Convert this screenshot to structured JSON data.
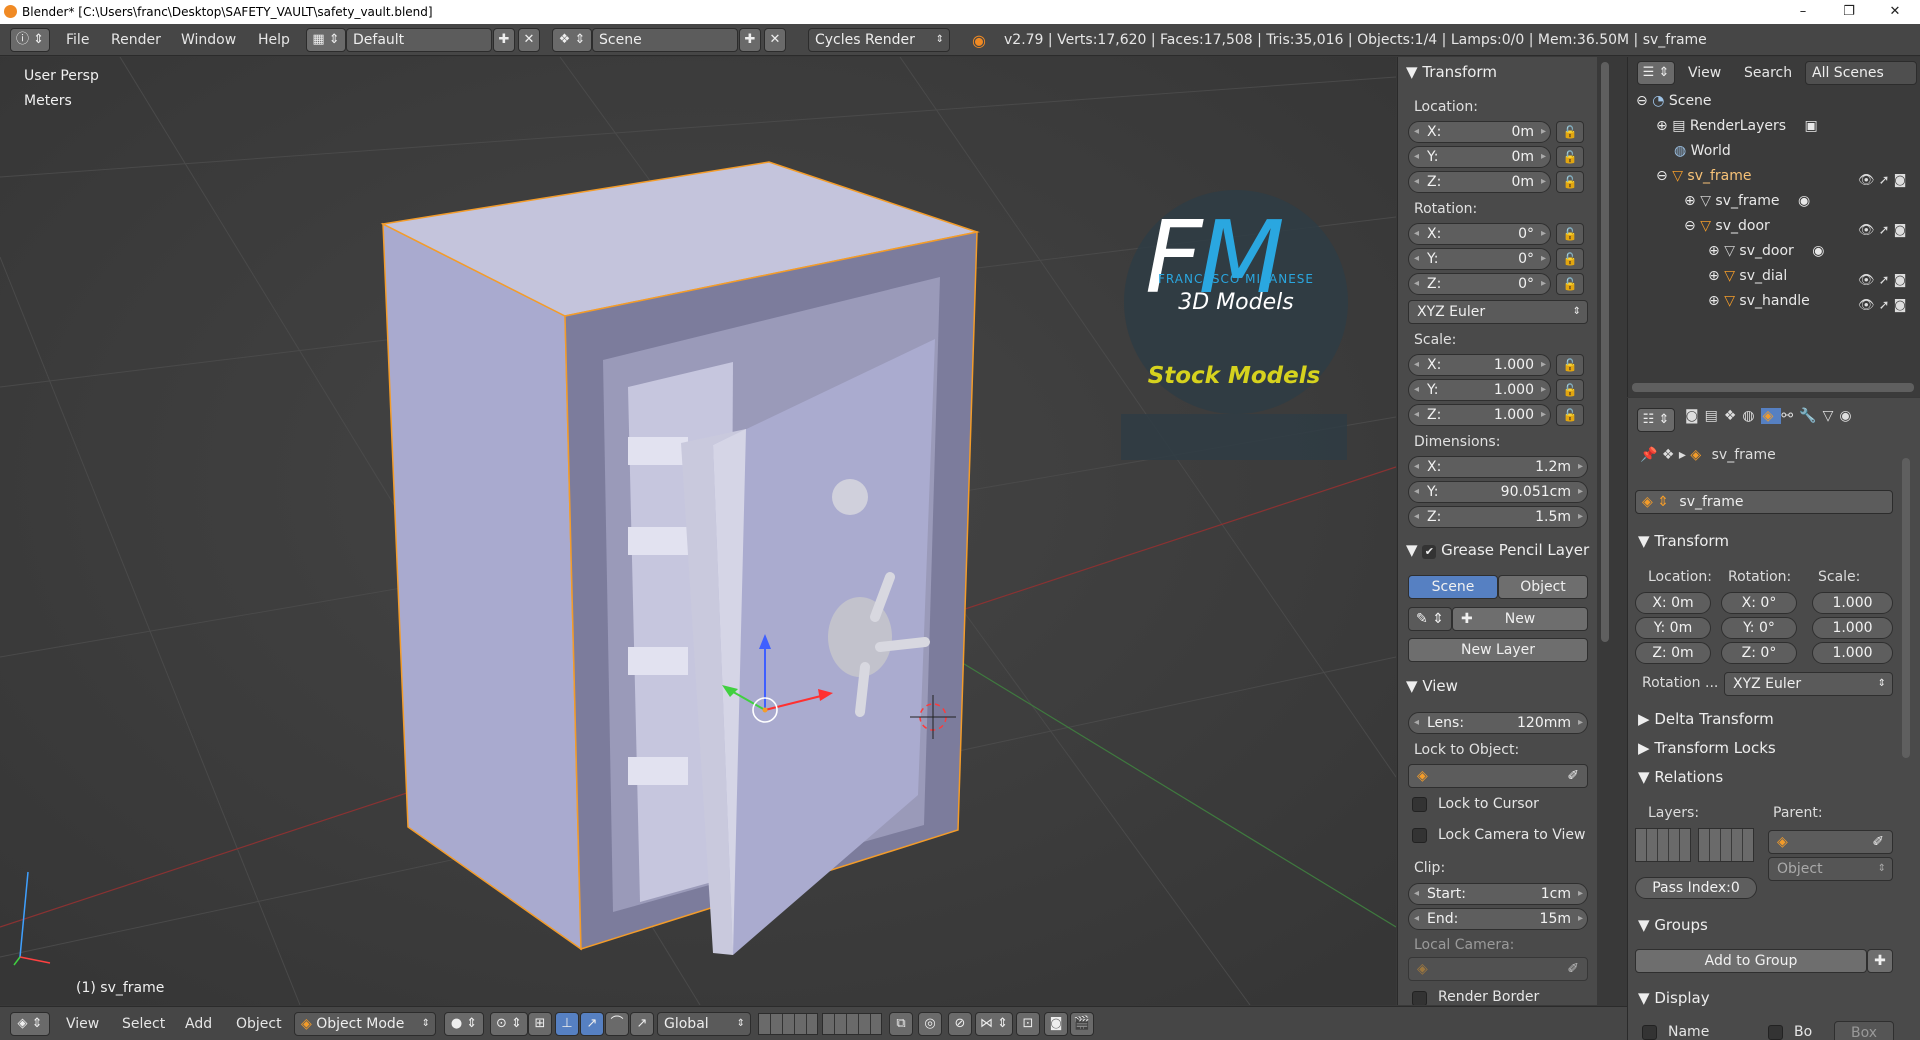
{
  "window": {
    "title": "Blender* [C:\\Users\\franc\\Desktop\\SAFETY_VAULT\\safety_vault.blend]",
    "minimize": "–",
    "maximize": "❐",
    "close": "✕"
  },
  "topbar": {
    "menus": [
      "File",
      "Render",
      "Window",
      "Help"
    ],
    "layout": "Default",
    "scene": "Scene",
    "engine": "Cycles Render",
    "stats": "v2.79 | Verts:17,620 | Faces:17,508 | Tris:35,016 | Objects:1/4 | Lamps:0/0 | Mem:36.50M | sv_frame"
  },
  "viewport": {
    "view_name": "User Persp",
    "units": "Meters",
    "object_label": "(1) sv_frame",
    "watermark": {
      "logo_letters": "FM",
      "author": "FRANCESCO MILANESE",
      "subtitle": "3D Models",
      "badge": "Stock Models"
    }
  },
  "npanel": {
    "transform": {
      "title": "Transform",
      "location_label": "Location:",
      "location": [
        {
          "axis": "X:",
          "value": "0m"
        },
        {
          "axis": "Y:",
          "value": "0m"
        },
        {
          "axis": "Z:",
          "value": "0m"
        }
      ],
      "rotation_label": "Rotation:",
      "rotation": [
        {
          "axis": "X:",
          "value": "0°"
        },
        {
          "axis": "Y:",
          "value": "0°"
        },
        {
          "axis": "Z:",
          "value": "0°"
        }
      ],
      "rotation_mode": "XYZ Euler",
      "scale_label": "Scale:",
      "scale": [
        {
          "axis": "X:",
          "value": "1.000"
        },
        {
          "axis": "Y:",
          "value": "1.000"
        },
        {
          "axis": "Z:",
          "value": "1.000"
        }
      ],
      "dimensions_label": "Dimensions:",
      "dimensions": [
        {
          "axis": "X:",
          "value": "1.2m"
        },
        {
          "axis": "Y:",
          "value": "90.051cm"
        },
        {
          "axis": "Z:",
          "value": "1.5m"
        }
      ]
    },
    "grease": {
      "title": "Grease Pencil Layer",
      "tab_scene": "Scene",
      "tab_object": "Object",
      "new": "New",
      "new_layer": "New Layer"
    },
    "view": {
      "title": "View",
      "lens_label": "Lens:",
      "lens": "120mm",
      "lock_object_label": "Lock to Object:",
      "lock_cursor": "Lock to Cursor",
      "lock_camera": "Lock Camera to View",
      "clip_label": "Clip:",
      "clip_start_label": "Start:",
      "clip_start": "1cm",
      "clip_end_label": "End:",
      "clip_end": "15m",
      "local_camera_label": "Local Camera:",
      "render_border": "Render Border"
    }
  },
  "outliner": {
    "menu_view": "View",
    "menu_search": "Search",
    "filter": "All Scenes",
    "items": [
      {
        "name": "Scene"
      },
      {
        "name": "RenderLayers"
      },
      {
        "name": "World"
      },
      {
        "name": "sv_frame"
      },
      {
        "name": "sv_frame"
      },
      {
        "name": "sv_door"
      },
      {
        "name": "sv_door"
      },
      {
        "name": "sv_dial"
      },
      {
        "name": "sv_handle"
      }
    ]
  },
  "properties": {
    "breadcrumb": "sv_frame",
    "object_name": "sv_frame",
    "transform_title": "Transform",
    "location_label": "Location:",
    "rotation_label": "Rotation:",
    "scale_label": "Scale:",
    "loc": [
      "X: 0m",
      "Y: 0m",
      "Z: 0m"
    ],
    "rot": [
      "X:  0°",
      "Y:  0°",
      "Z:  0°"
    ],
    "scl": [
      "1.000",
      "1.000",
      "1.000"
    ],
    "rotation_mode_label": "Rotation ...",
    "rotation_mode": "XYZ Euler",
    "delta_transform": "Delta Transform",
    "transform_locks": "Transform Locks",
    "relations": "Relations",
    "layers_label": "Layers:",
    "parent_label": "Parent:",
    "parent_type": "Object",
    "pass_index": "Pass Index:0",
    "groups": "Groups",
    "add_to_group": "Add to Group",
    "display": "Display",
    "name_label": "Name",
    "bo_label": "Bo",
    "box_label": "Box"
  },
  "bottombar": {
    "menus": [
      "View",
      "Select",
      "Add",
      "Object"
    ],
    "mode": "Object Mode",
    "orientation": "Global"
  },
  "colors": {
    "accent_blue": "#5680c2",
    "watermark_blue": "#2aa7e0",
    "badge_yellow": "#d6d21e",
    "selection_orange": "#f39c2a"
  }
}
